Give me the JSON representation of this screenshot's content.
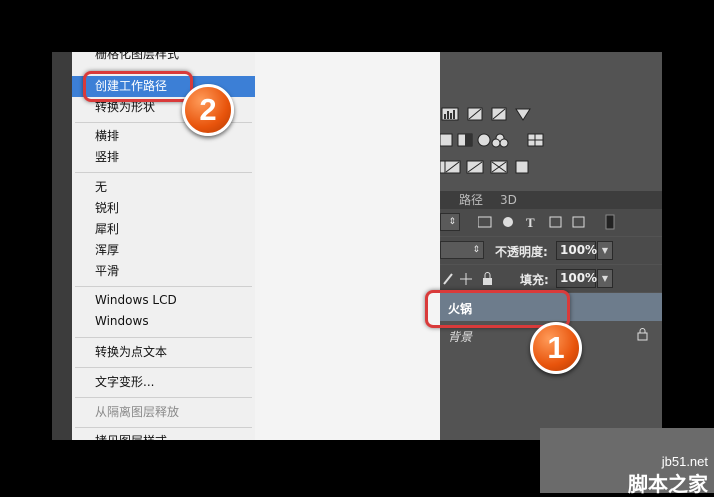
{
  "menu": {
    "items": [
      {
        "label": "栅格化图层样式",
        "state": "partial"
      },
      {
        "label": "创建工作路径",
        "state": "highlighted"
      },
      {
        "label": "转换为形状",
        "state": "normal"
      },
      {
        "label": "横排",
        "state": "normal"
      },
      {
        "label": "竖排",
        "state": "normal"
      },
      {
        "label": "无",
        "state": "normal"
      },
      {
        "label": "锐利",
        "state": "normal"
      },
      {
        "label": "犀利",
        "state": "normal"
      },
      {
        "label": "浑厚",
        "state": "normal"
      },
      {
        "label": "平滑",
        "state": "normal"
      },
      {
        "label": "Windows LCD",
        "state": "normal"
      },
      {
        "label": "Windows",
        "state": "normal"
      },
      {
        "label": "转换为点文本",
        "state": "normal"
      },
      {
        "label": "文字变形...",
        "state": "normal"
      },
      {
        "label": "从隔离图层释放",
        "state": "disabled"
      },
      {
        "label": "拷贝图层样式",
        "state": "partial"
      }
    ]
  },
  "panel": {
    "tabs": [
      "路径",
      "3D"
    ],
    "kind_filter_icon": "T-text-icon",
    "opacity_label": "不透明度:",
    "opacity_value": "100%",
    "fill_label": "填充:",
    "fill_value": "100%",
    "layers": [
      {
        "name": "火锅",
        "selected": true
      },
      {
        "name": "背景",
        "selected": false,
        "locked": true
      }
    ]
  },
  "annotations": {
    "badge_1": "1",
    "badge_2": "2"
  },
  "watermark": {
    "domain": "jb51.net",
    "site_name": "脚本之家"
  },
  "colors": {
    "menu_highlight": "#3c7fd6",
    "callout_red": "#d93a3a",
    "badge_orange": "#e8540c",
    "selected_layer": "#6d7c8c"
  }
}
